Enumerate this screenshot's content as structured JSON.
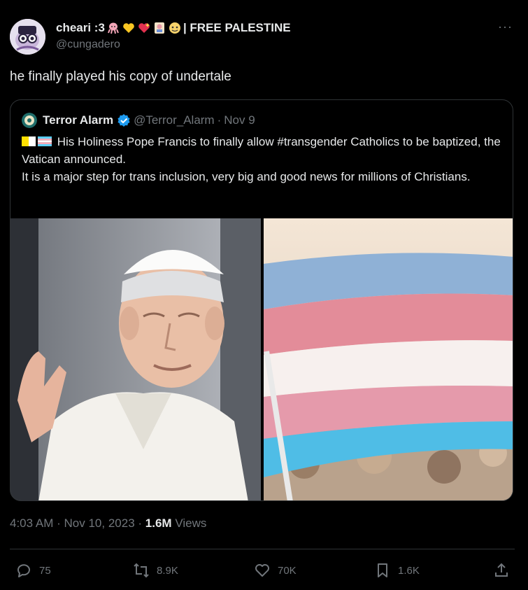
{
  "author": {
    "display_name": "cheari :3",
    "name_suffix": "| FREE PALESTINE",
    "handle": "@cungadero",
    "more_label": "···"
  },
  "tweet": {
    "text": "he finally played his copy of undertale"
  },
  "quoted": {
    "name": "Terror Alarm",
    "handle": "@Terror_Alarm",
    "separator": "·",
    "date": "Nov 9",
    "line1": "His Holiness Pope Francis to finally allow #transgender Catholics to be baptized, the Vatican announced.",
    "line2": "It is a major step for trans inclusion, very big and good news for millions of Christians."
  },
  "meta": {
    "time": "4:03 AM",
    "sep1": "·",
    "date": "Nov 10, 2023",
    "sep2": "·",
    "views_count": "1.6M",
    "views_label": "Views"
  },
  "actions": {
    "replies": "75",
    "retweets": "8.9K",
    "likes": "70K",
    "bookmarks": "1.6K"
  },
  "colors": {
    "background": "#000000",
    "text": "#e7e9ea",
    "muted": "#71767b",
    "border": "#2f3336",
    "verified": "#1d9bf0",
    "trans_blue": "#5bcefa",
    "trans_pink": "#f5a9b8"
  }
}
